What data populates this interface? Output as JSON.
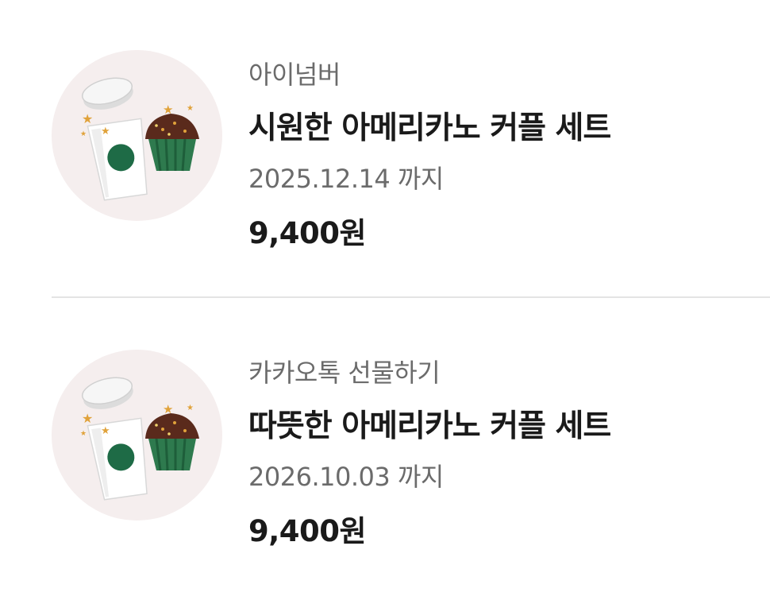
{
  "coupons": [
    {
      "sender": "아이넘버",
      "product_name": "시원한 아메리카노 커플 세트",
      "expiry": "2025.12.14 까지",
      "price": "9,400원",
      "thumbnail_icon": "coffee-cupcake-icon"
    },
    {
      "sender": "카카오톡 선물하기",
      "product_name": "따뜻한 아메리카노 커플 세트",
      "expiry": "2026.10.03 까지",
      "price": "9,400원",
      "thumbnail_icon": "coffee-cupcake-icon"
    }
  ],
  "colors": {
    "thumb_bg": "#f5eeee",
    "cup_logo": "#1e6b46",
    "cupcake_liner": "#2e7a4e",
    "cupcake_top": "#5a2a1c",
    "star": "#e0a23a",
    "title_text": "#1a1a1a",
    "meta_text": "#6b6b6b"
  }
}
